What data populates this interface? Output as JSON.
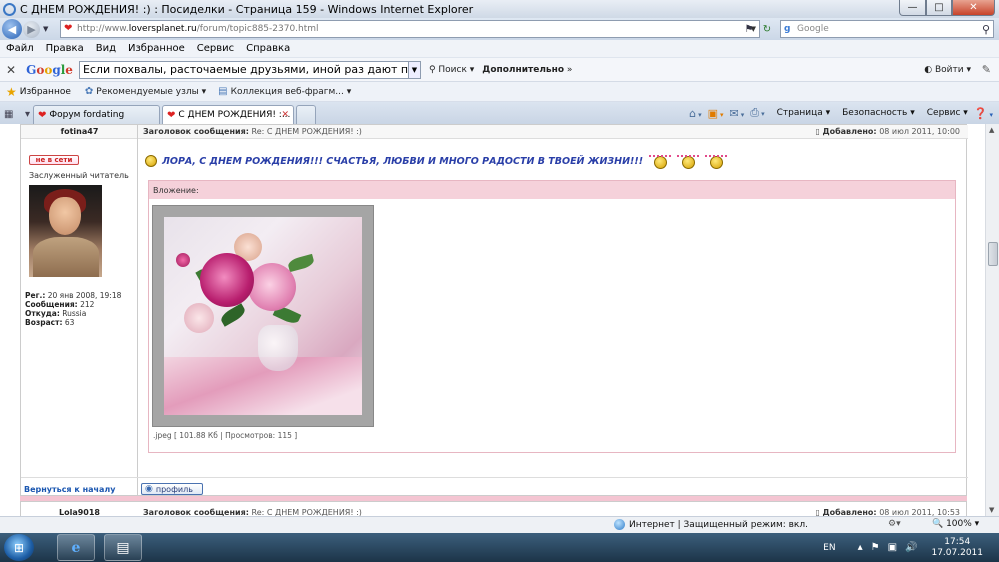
{
  "window": {
    "title": "С ДНЕМ РОЖДЕНИЯ! :) : Посиделки - Страница 159 - Windows Internet Explorer"
  },
  "address": {
    "url_prefix": "http://www.",
    "url_host": "loversplanet.ru",
    "url_path": "/forum/topic885-2370.html",
    "search_placeholder": "Google"
  },
  "menu": {
    "items": [
      "Файл",
      "Правка",
      "Вид",
      "Избранное",
      "Сервис",
      "Справка"
    ]
  },
  "google_toolbar": {
    "logo": [
      "G",
      "o",
      "o",
      "g",
      "l",
      "e"
    ],
    "query": "Если похвалы, расточаемые друзьями, иной раз дают повод у",
    "search_label": "Поиск",
    "more_label": "Дополнительно",
    "signin_label": "Войти"
  },
  "favorites": {
    "label": "Избранное",
    "items": [
      "Рекомендуемые узлы",
      "Коллекция веб-фрагм..."
    ]
  },
  "tabs": [
    {
      "label": "Форум fordating"
    },
    {
      "label": "С ДНЕМ РОЖДЕНИЯ! :..."
    }
  ],
  "command_bar": {
    "page": "Страница",
    "safety": "Безопасность",
    "tools": "Сервис"
  },
  "post": {
    "author": "fotina47",
    "subject_label": "Заголовок сообщения:",
    "subject": "Re: С ДНЕМ РОЖДЕНИЯ! :)",
    "added_label": "Добавлено:",
    "added_date": "08 июл 2011, 10:00",
    "online_badge": "не в сети",
    "rank": "Заслуженный читатель",
    "stats": [
      {
        "label": "Рег.:",
        "value": "20 янв 2008, 19:18"
      },
      {
        "label": "Сообщения:",
        "value": "212"
      },
      {
        "label": "Откуда:",
        "value": "Russia"
      },
      {
        "label": "Возраст:",
        "value": "63"
      }
    ],
    "message": "ЛОРА, С ДНЕМ РОЖДЕНИЯ!!! СЧАСТЬЯ, ЛЮБВИ И МНОГО РАДОСТИ В ТВОЕЙ ЖИЗНИ!!!",
    "attachment_label": "Вложение:",
    "attachment_caption": ".jpeg [ 101.88 Кб | Просмотров: 115 ]",
    "back_to_top": "Вернуться к началу",
    "profile_button": "профиль"
  },
  "next_post": {
    "author": "Lola9018",
    "subject_label": "Заголовок сообщения:",
    "subject": "Re: С ДНЕМ РОЖДЕНИЯ! :)",
    "added_label": "Добавлено:",
    "added_date": "08 июл 2011, 10:53"
  },
  "status": {
    "zone": "Интернет | Защищенный режим: вкл.",
    "zoom": "100%"
  },
  "taskbar": {
    "lang": "EN",
    "time": "17:54",
    "date": "17.07.2011"
  },
  "colors": {
    "message": "#2a3fa8",
    "attachment_header": "#f5d1da",
    "link": "#1a56b0"
  }
}
